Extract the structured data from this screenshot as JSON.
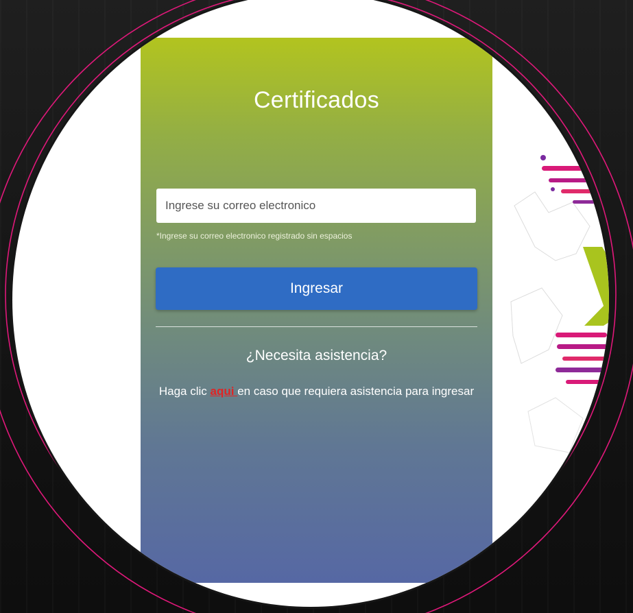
{
  "login": {
    "title": "Certificados",
    "email_placeholder": "Ingrese su correo electronico",
    "email_help": "*Ingrese su correo electronico registrado sin espacios",
    "submit_label": "Ingresar"
  },
  "assistance": {
    "title": "¿Necesita asistencia?",
    "text_before": "Haga clic ",
    "link_label": "aqui ",
    "text_after": "en caso que requiera asistencia para ingresar"
  },
  "colors": {
    "panel_top": "#b2c41f",
    "panel_bottom": "#5668a4",
    "button": "#2f6cc4",
    "link": "#e02424",
    "ring": "#e0187a"
  }
}
